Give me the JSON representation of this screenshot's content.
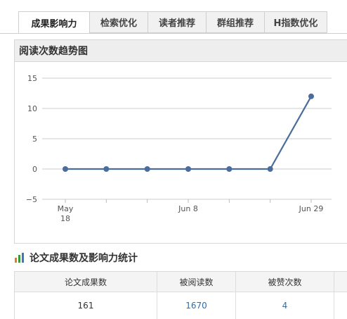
{
  "tabs": [
    {
      "label": "成果影响力",
      "active": true
    },
    {
      "label": "检索优化",
      "active": false
    },
    {
      "label": "读者推荐",
      "active": false
    },
    {
      "label": "群组推荐",
      "active": false
    },
    {
      "label": "H指数优化",
      "active": false
    }
  ],
  "chart_panel": {
    "title": "阅读次数趋势图"
  },
  "chart_data": {
    "type": "line",
    "title": "阅读次数趋势图",
    "xlabel": "",
    "ylabel": "",
    "x_tick_labels": [
      "May 18",
      "Jun 8",
      "Jun 29"
    ],
    "y_ticks": [
      15,
      10,
      5,
      0,
      -5
    ],
    "ylim": [
      -5,
      15
    ],
    "grid": true,
    "series": [
      {
        "values": [
          0,
          0,
          0,
          0,
          0,
          0,
          12
        ],
        "color": "#4a6d9c"
      }
    ]
  },
  "stats": {
    "title": "论文成果数及影响力统计",
    "icon": "bar-chart-icon",
    "headers": [
      "论文成果数",
      "被阅读数",
      "被赞次数"
    ],
    "values": [
      "161",
      "1670",
      "4"
    ]
  },
  "colors": {
    "line": "#4a6d9c",
    "link": "#2a6fb0",
    "grid": "#cccccc"
  }
}
